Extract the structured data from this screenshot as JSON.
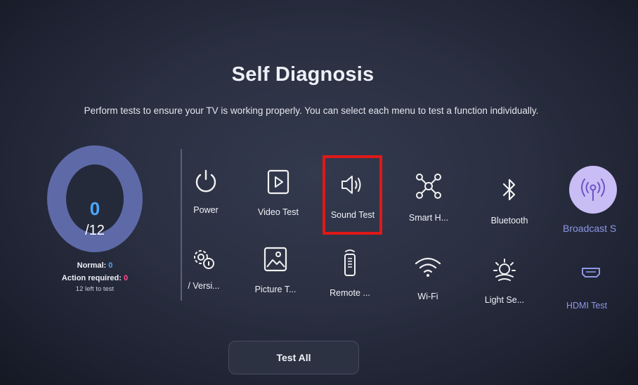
{
  "header": {
    "title": "Self Diagnosis",
    "subtitle": "Perform tests to ensure your TV is working properly. You can select each menu to test a function individually."
  },
  "progress": {
    "completed": "0",
    "total": "/12",
    "normal_label": "Normal:",
    "normal_value": "0",
    "action_label": "Action required:",
    "action_value": "0",
    "left_text": "12 left to test"
  },
  "tests": {
    "power": "Power",
    "video": "Video Test",
    "sound": "Sound Test",
    "smart_home": "Smart H...",
    "bluetooth": "Bluetooth",
    "broadcast": "Broadcast S",
    "version": "/ Versi...",
    "picture": "Picture T...",
    "remote": "Remote ...",
    "wifi": "Wi-Fi",
    "light": "Light Se...",
    "hdmi": "HDMI Test"
  },
  "actions": {
    "test_all": "Test All"
  },
  "colors": {
    "accent_blue": "#4aa8ff",
    "alert_pink": "#ff4f8e",
    "ring": "#5e6aa8",
    "highlight_box": "#e01818",
    "broadcast_circle": "#c9bdf5"
  },
  "icons": {
    "power": "power-icon",
    "video": "play-icon",
    "sound": "speaker-icon",
    "smart_home": "network-hub-icon",
    "bluetooth": "bluetooth-icon",
    "broadcast": "antenna-icon",
    "version": "gear-info-icon",
    "picture": "image-icon",
    "remote": "remote-icon",
    "wifi": "wifi-icon",
    "light": "light-sensor-icon",
    "hdmi": "hdmi-icon"
  }
}
